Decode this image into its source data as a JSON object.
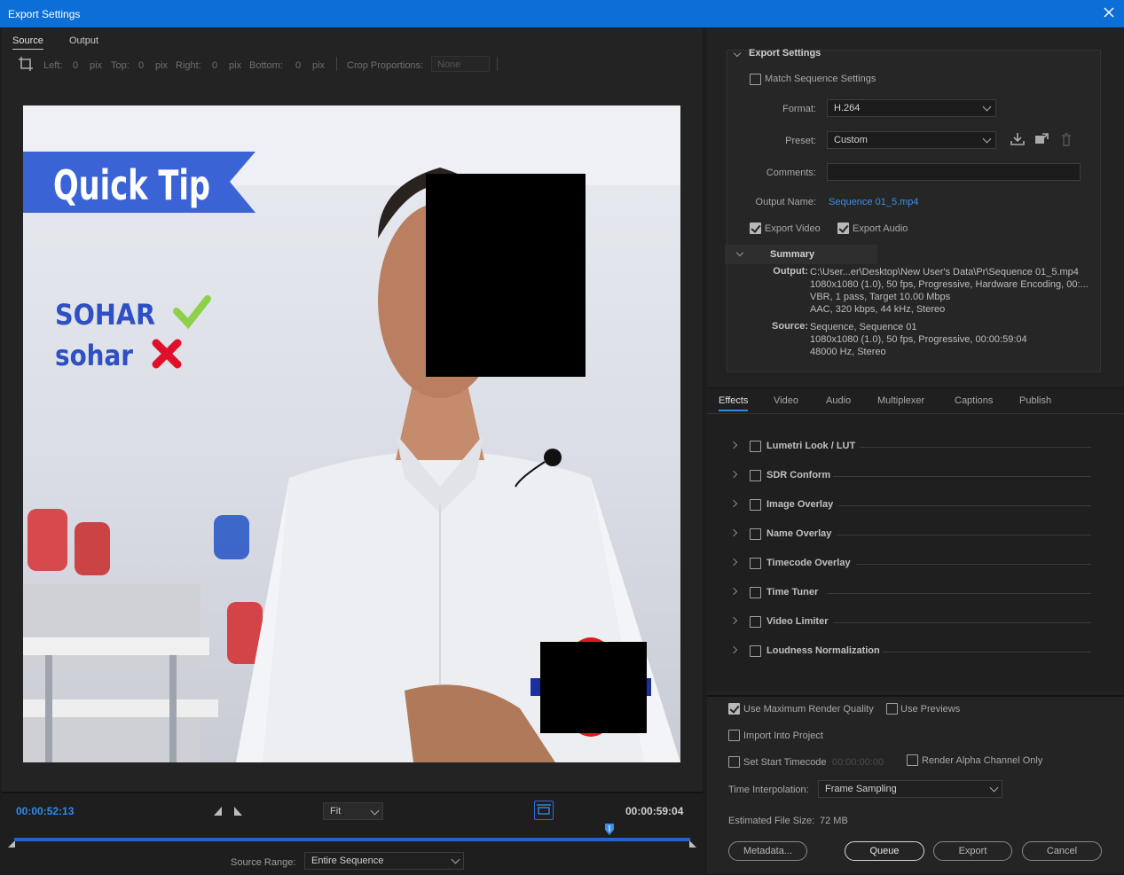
{
  "window": {
    "title": "Export Settings"
  },
  "source_panel": {
    "tabs": [
      "Source",
      "Output"
    ],
    "crop": {
      "left_label": "Left:",
      "left_value": "0",
      "left_unit": "pix",
      "top_label": "Top:",
      "top_value": "0",
      "top_unit": "pix",
      "right_label": "Right:",
      "right_value": "0",
      "right_unit": "pix",
      "bottom_label": "Bottom:",
      "bottom_value": "0",
      "bottom_unit": "pix",
      "proportions_label": "Crop Proportions:",
      "proportions_value": "None"
    },
    "video_overlay": {
      "banner_text": "Quick Tip",
      "correct_text": "SOHAR",
      "wrong_text": "sohar",
      "banner_color": "#3a63d6",
      "text_color": "#2f4fc4",
      "check_color": "#8dd04a",
      "cross_color": "#e0102a"
    },
    "player": {
      "current_time": "00:00:52:13",
      "end_time": "00:00:59:04",
      "zoom": "Fit",
      "playhead_fraction": 0.88,
      "source_range_label": "Source Range:",
      "source_range_value": "Entire Sequence"
    }
  },
  "export_settings": {
    "section_title": "Export Settings",
    "match_sequence_label": "Match Sequence Settings",
    "match_sequence_checked": false,
    "format_label": "Format:",
    "format_value": "H.264",
    "preset_label": "Preset:",
    "preset_value": "Custom",
    "comments_label": "Comments:",
    "comments_value": "",
    "output_name_label": "Output Name:",
    "output_name_value": "Sequence 01_5.mp4",
    "export_video_label": "Export Video",
    "export_video_checked": true,
    "export_audio_label": "Export Audio",
    "export_audio_checked": true,
    "summary": {
      "title": "Summary",
      "output_label": "Output:",
      "output_lines": [
        "C:\\User...er\\Desktop\\New User's Data\\Pr\\Sequence 01_5.mp4",
        "1080x1080 (1.0), 50 fps, Progressive, Hardware Encoding, 00:...",
        "VBR, 1 pass, Target 10.00 Mbps",
        "AAC, 320 kbps, 44 kHz, Stereo"
      ],
      "source_label": "Source:",
      "source_lines": [
        "Sequence, Sequence 01",
        "1080x1080 (1.0), 50 fps, Progressive, 00:00:59:04",
        "48000 Hz, Stereo"
      ]
    }
  },
  "effects_panel": {
    "tabs": [
      "Effects",
      "Video",
      "Audio",
      "Multiplexer",
      "Captions",
      "Publish"
    ],
    "effects": [
      "Lumetri Look / LUT",
      "SDR Conform",
      "Image Overlay",
      "Name Overlay",
      "Timecode Overlay",
      "Time Tuner",
      "Video Limiter",
      "Loudness Normalization"
    ]
  },
  "bottom_options": {
    "max_render_quality_label": "Use Maximum Render Quality",
    "max_render_quality_checked": true,
    "use_previews_label": "Use Previews",
    "import_into_project_label": "Import Into Project",
    "set_start_timecode_label": "Set Start Timecode",
    "start_timecode_value": "00:00:00:00",
    "render_alpha_label": "Render Alpha Channel Only",
    "time_interpolation_label": "Time Interpolation:",
    "time_interpolation_value": "Frame Sampling",
    "estimated_size_label": "Estimated File Size:",
    "estimated_size_value": "72 MB",
    "buttons": {
      "metadata": "Metadata...",
      "queue": "Queue",
      "export": "Export",
      "cancel": "Cancel"
    }
  }
}
